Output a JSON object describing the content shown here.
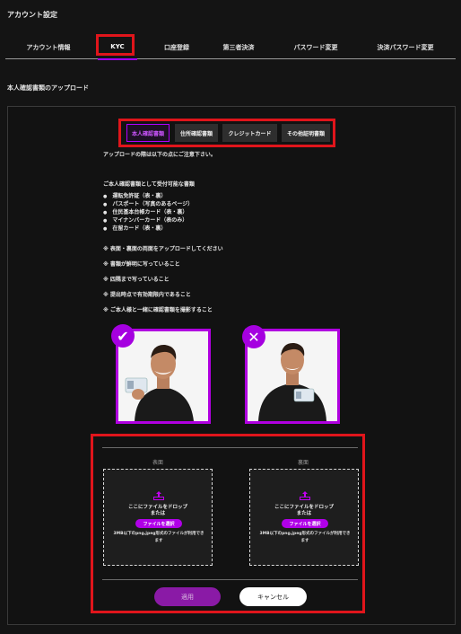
{
  "page": {
    "title": "アカウント設定"
  },
  "tabs": [
    "アカウント情報",
    "KYC",
    "口座登録",
    "第三者決済",
    "パスワード変更",
    "決済パスワード変更"
  ],
  "section_title": "本人確認書類のアップロード",
  "doc_tabs": [
    "本人確認書類",
    "住所確認書類",
    "クレジットカード",
    "その他証明書類"
  ],
  "intro": "アップロードの際は以下の点にご注意下さい。",
  "accepted_heading": "ご本人確認書類として受付可能な書類",
  "accepted_docs": [
    "運転免許証（表・裏）",
    "パスポート（写真のあるページ）",
    "住民基本台帳カード（表・裏）",
    "マイナンバーカード（表のみ）",
    "在留カード（表・裏）"
  ],
  "notes": [
    "※ 表面・裏面の両面をアップロードしてください",
    "※ 書類が鮮明に写っていること",
    "※ 四隅まで写っていること",
    "※ 提出時点で有効期限内であること",
    "※ ご本人様と一緒に確認書類を撮影すること"
  ],
  "examples": {
    "good_mark": "✔",
    "bad_mark": "✕"
  },
  "upload": {
    "front_label": "表面",
    "back_label": "裏面",
    "drop_text": "ここにファイルをドロップ",
    "or_text": "または",
    "select_button": "ファイルを選択",
    "size_note": "3MB以下のpng,jpeg形式のファイルが利用できます"
  },
  "actions": {
    "apply": "適用",
    "cancel": "キャンセル"
  },
  "colors": {
    "accent": "#b000e8",
    "highlight": "#e0151b",
    "background": "#141414"
  }
}
